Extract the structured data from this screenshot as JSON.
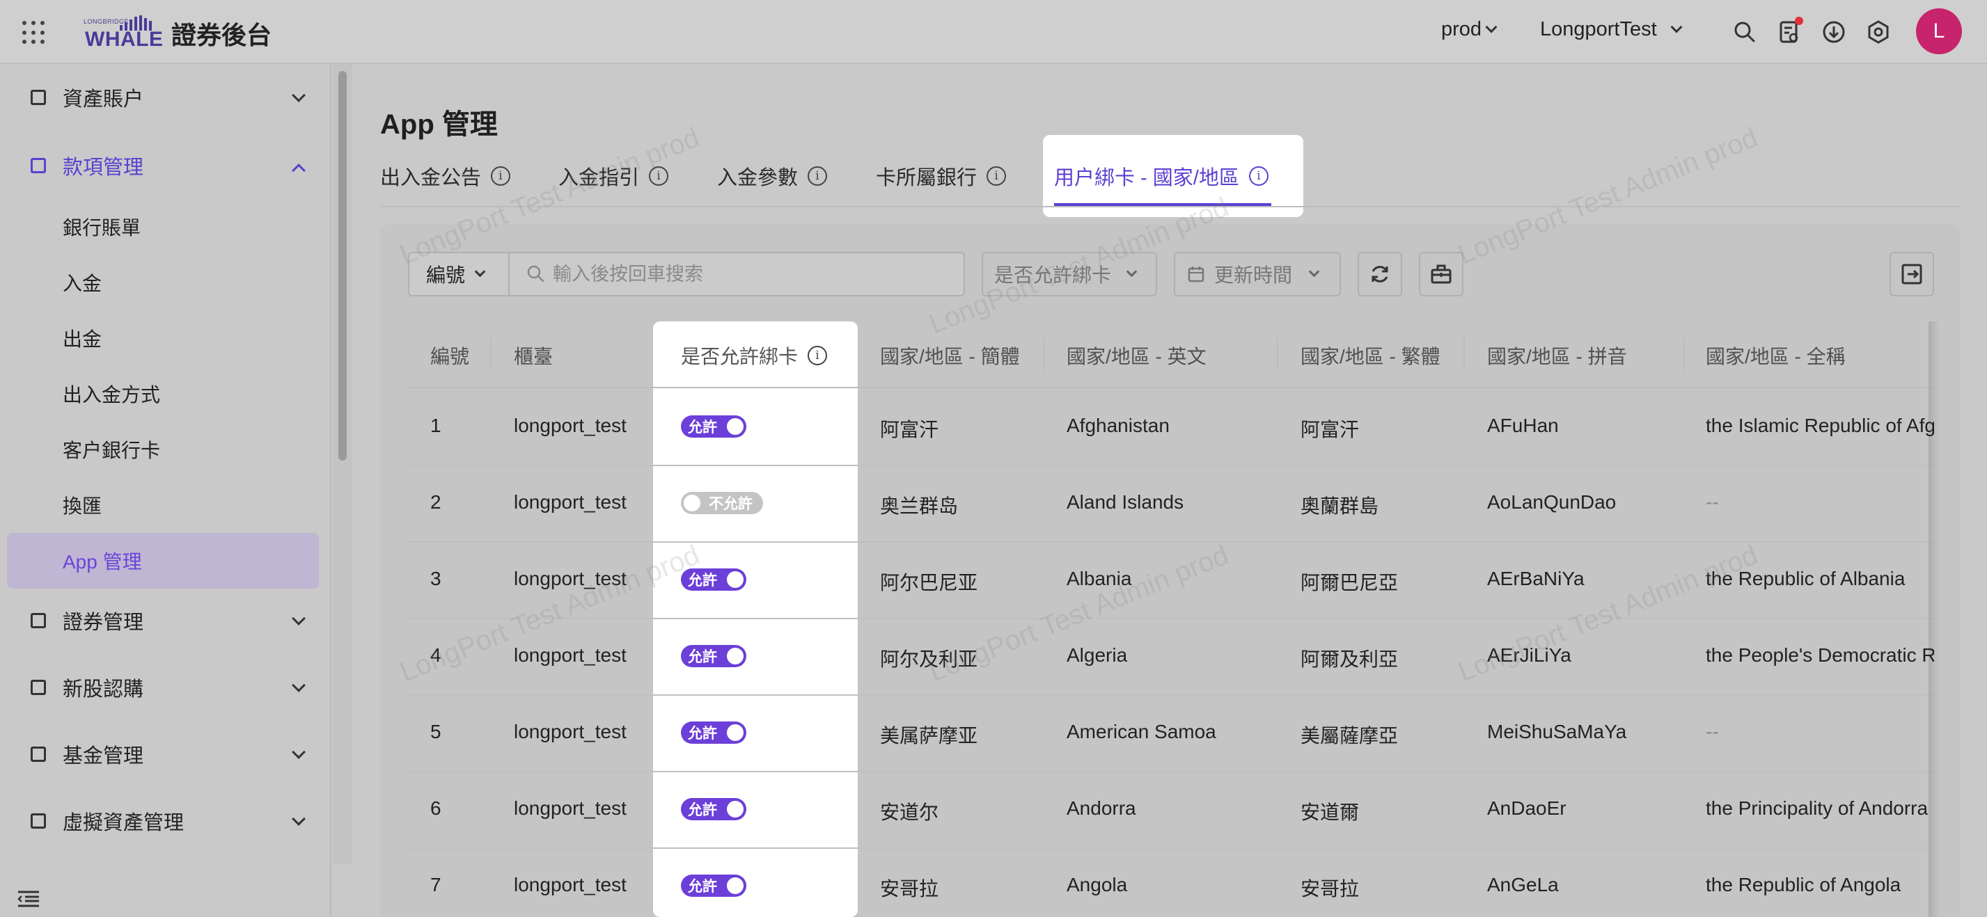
{
  "header": {
    "logo_small": "LONGBRIDGE",
    "logo_big": "WHALE",
    "app_title": "證券後台",
    "env": "prod",
    "tenant": "LongportTest",
    "avatar_letter": "L"
  },
  "sidebar": {
    "groups": [
      {
        "label": "資產賬户",
        "open": false
      },
      {
        "label": "款項管理",
        "open": true
      },
      {
        "label": "證券管理",
        "open": false
      },
      {
        "label": "新股認購",
        "open": false
      },
      {
        "label": "基金管理",
        "open": false
      },
      {
        "label": "虛擬資產管理",
        "open": false
      }
    ],
    "sub_items": [
      "銀行賬單",
      "入金",
      "出金",
      "出入金方式",
      "客户銀行卡",
      "換匯",
      "App 管理"
    ],
    "active_item": "App 管理"
  },
  "page": {
    "title": "App 管理",
    "tabs": [
      "出入金公告",
      "入金指引",
      "入金參數",
      "卡所屬銀行",
      "用户綁卡 - 國家/地區"
    ],
    "active_tab": "用户綁卡 - 國家/地區"
  },
  "toolbar": {
    "field_select": "編號",
    "search_placeholder": "輸入後按回車搜索",
    "allow_filter": "是否允許綁卡",
    "time_filter": "更新時間"
  },
  "table": {
    "columns": [
      "編號",
      "櫃臺",
      "是否允許綁卡",
      "國家/地區 - 簡體",
      "國家/地區 - 英文",
      "國家/地區 - 繁體",
      "國家/地區 - 拼音",
      "國家/地區 - 全稱"
    ],
    "switch_on_label": "允許",
    "switch_off_label": "不允許",
    "rows": [
      {
        "id": "1",
        "counter": "longport_test",
        "allowed": true,
        "cn_simp": "阿富汗",
        "en": "Afghanistan",
        "cn_trad": "阿富汗",
        "pinyin": "AFuHan",
        "full": "the Islamic Republic of Afghanistan"
      },
      {
        "id": "2",
        "counter": "longport_test",
        "allowed": false,
        "cn_simp": "奥兰群岛",
        "en": "Aland Islands",
        "cn_trad": "奧蘭群島",
        "pinyin": "AoLanQunDao",
        "full": "--"
      },
      {
        "id": "3",
        "counter": "longport_test",
        "allowed": true,
        "cn_simp": "阿尔巴尼亚",
        "en": "Albania",
        "cn_trad": "阿爾巴尼亞",
        "pinyin": "AErBaNiYa",
        "full": "the Republic of Albania"
      },
      {
        "id": "4",
        "counter": "longport_test",
        "allowed": true,
        "cn_simp": "阿尔及利亚",
        "en": "Algeria",
        "cn_trad": "阿爾及利亞",
        "pinyin": "AErJiLiYa",
        "full": "the People's Democratic Republic of Algeria"
      },
      {
        "id": "5",
        "counter": "longport_test",
        "allowed": true,
        "cn_simp": "美属萨摩亚",
        "en": "American Samoa",
        "cn_trad": "美屬薩摩亞",
        "pinyin": "MeiShuSaMaYa",
        "full": "--"
      },
      {
        "id": "6",
        "counter": "longport_test",
        "allowed": true,
        "cn_simp": "安道尔",
        "en": "Andorra",
        "cn_trad": "安道爾",
        "pinyin": "AnDaoEr",
        "full": "the Principality of Andorra"
      },
      {
        "id": "7",
        "counter": "longport_test",
        "allowed": true,
        "cn_simp": "安哥拉",
        "en": "Angola",
        "cn_trad": "安哥拉",
        "pinyin": "AnGeLa",
        "full": "the Republic of Angola"
      }
    ]
  },
  "watermark_text": "LongPort Test Admin prod",
  "colors": {
    "accent": "#5b3fd1",
    "switch_on": "#6c3fd8",
    "avatar": "#c8246d"
  }
}
